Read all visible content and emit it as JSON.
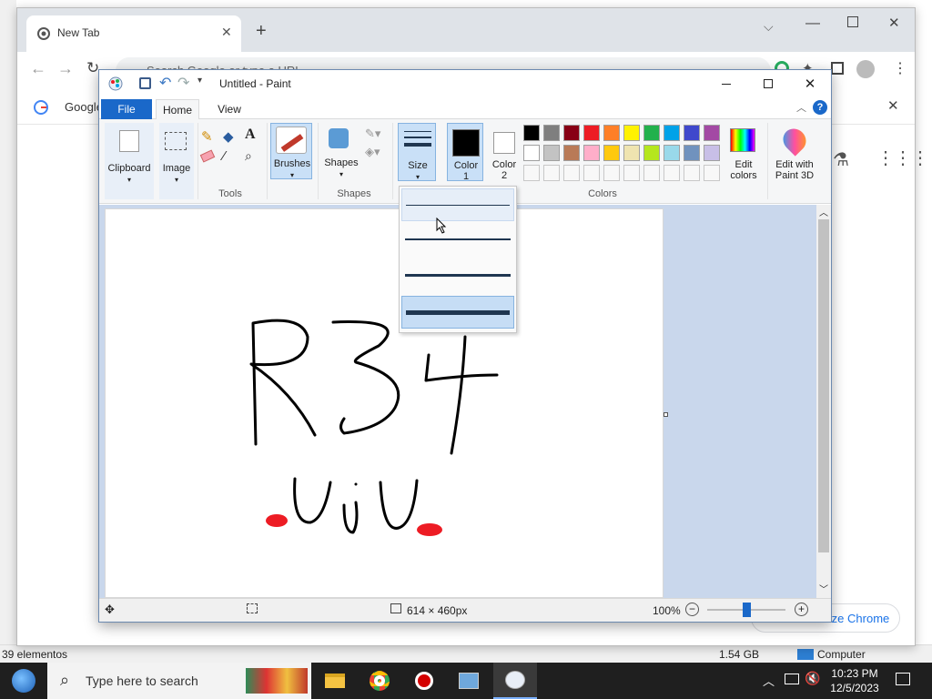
{
  "explorer": {
    "status_items": "39 elementos",
    "status_size": "1.54 GB",
    "status_location": "Computer"
  },
  "chrome": {
    "tab_title": "New Tab",
    "omnibox_placeholder": "Search Google or type a URL",
    "bookmark_label": "Google",
    "customize_label": "Customize Chrome"
  },
  "paint": {
    "title": "Untitled - Paint",
    "tabs": {
      "file": "File",
      "home": "Home",
      "view": "View"
    },
    "ribbon": {
      "clipboard": "Clipboard",
      "image": "Image",
      "tools_label": "Tools",
      "brushes": "Brushes",
      "shapes": "Shapes",
      "shapes_group": "Shapes",
      "size": "Size",
      "color1_a": "Color",
      "color1_b": "1",
      "color2_a": "Color",
      "color2_b": "2",
      "colors_group": "Colors",
      "edit_colors_a": "Edit",
      "edit_colors_b": "colors",
      "paint3d_a": "Edit with",
      "paint3d_b": "Paint 3D"
    },
    "palette_row1": [
      "#000000",
      "#7f7f7f",
      "#880015",
      "#ed1c24",
      "#ff7f27",
      "#fff200",
      "#22b14c",
      "#00a2e8",
      "#3f48cc",
      "#a349a4"
    ],
    "palette_row2": [
      "#ffffff",
      "#c3c3c3",
      "#b97a57",
      "#ffaec9",
      "#ffc90e",
      "#efe4b0",
      "#b5e61d",
      "#99d9ea",
      "#7092be",
      "#c8bfe7"
    ],
    "status": {
      "dimensions": "614 × 460px",
      "zoom": "100%"
    }
  },
  "taskbar": {
    "search_placeholder": "Type here to search",
    "time": "10:23 PM",
    "date": "12/5/2023"
  }
}
